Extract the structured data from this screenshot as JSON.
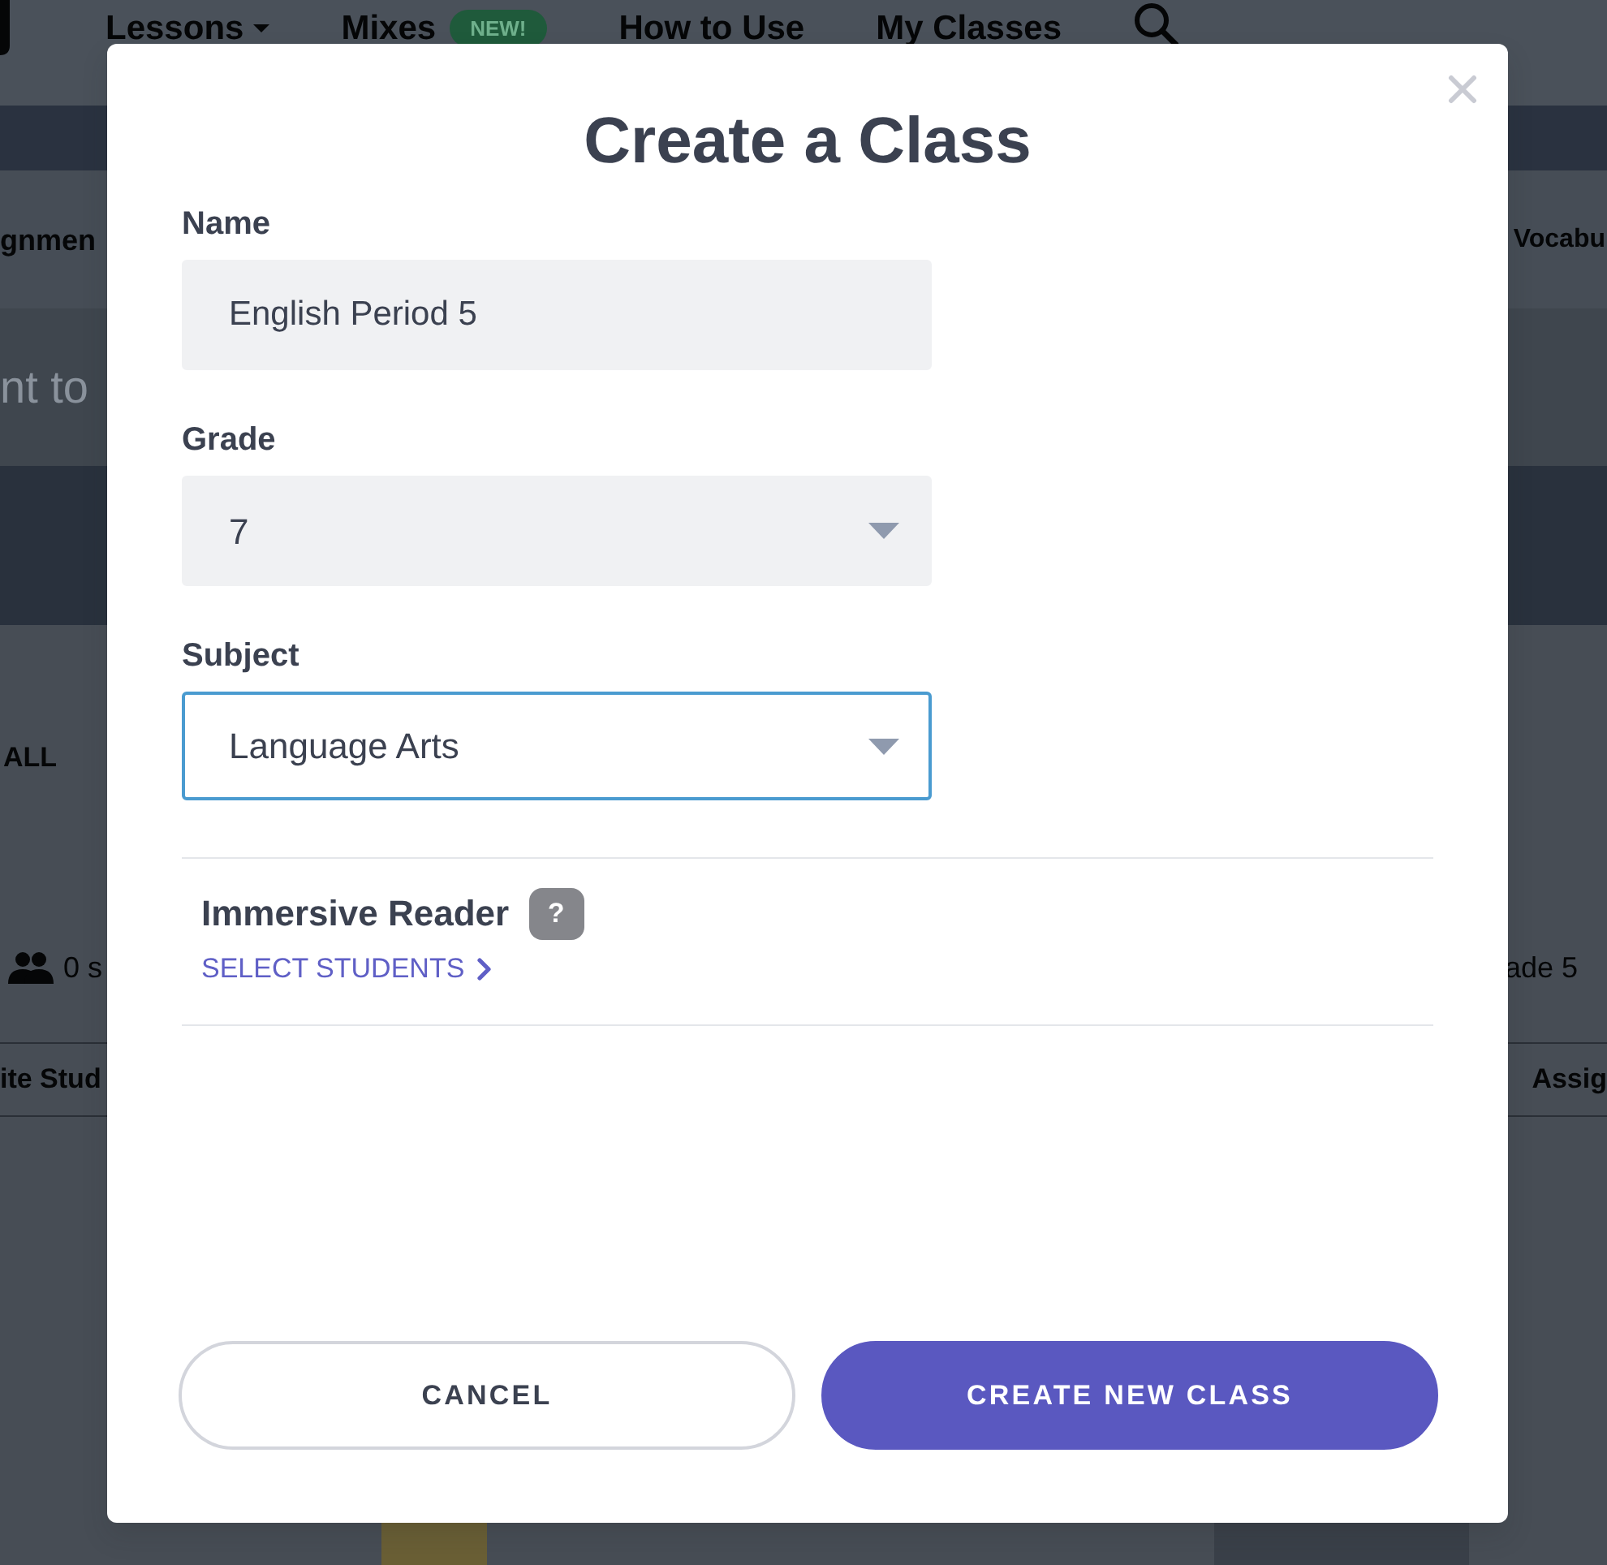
{
  "background": {
    "nav_items": [
      {
        "label": "Lessons",
        "dropdown": true
      },
      {
        "label": "Mixes",
        "dropdown": false,
        "badge": "NEW!"
      },
      {
        "label": "How to Use",
        "dropdown": false
      },
      {
        "label": "My Classes",
        "dropdown": false
      }
    ],
    "tabs_row": {
      "left": "gnmen",
      "right": "Vocabu"
    },
    "hint_row": {
      "left": "nt to"
    },
    "filter_row": {
      "left": "ALL"
    },
    "class_row": {
      "left": "0 s",
      "right": "ade 5"
    },
    "actions_row": {
      "left": "ite Stud",
      "right": "Assig"
    }
  },
  "dialog": {
    "title": "Create a Class",
    "fields": [
      {
        "label": "Name",
        "kind": "text",
        "value": "English Period 5",
        "focused": false
      },
      {
        "label": "Grade",
        "kind": "select",
        "value": "7",
        "focused": false
      },
      {
        "label": "Subject",
        "kind": "select",
        "value": "Language Arts",
        "focused": true
      }
    ],
    "immersive_reader": {
      "label": "Immersive Reader",
      "help": "?",
      "link": "SELECT STUDENTS"
    },
    "buttons": [
      {
        "label": "CANCEL",
        "kind": "cancel"
      },
      {
        "label": "CREATE NEW CLASS",
        "kind": "submit"
      }
    ]
  }
}
